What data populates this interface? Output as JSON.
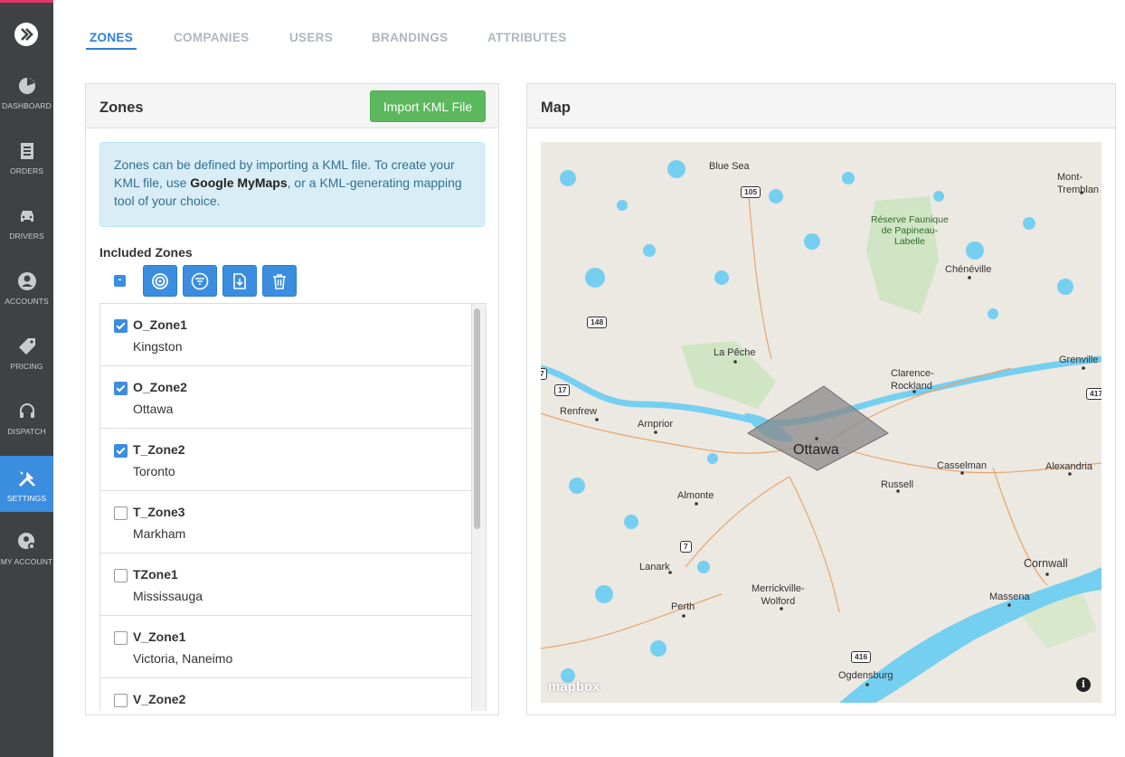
{
  "sidebar": {
    "items": [
      {
        "label": "DASHBOARD",
        "icon": "dashboard-icon"
      },
      {
        "label": "ORDERS",
        "icon": "orders-icon"
      },
      {
        "label": "DRIVERS",
        "icon": "car-icon"
      },
      {
        "label": "ACCOUNTS",
        "icon": "account-icon"
      },
      {
        "label": "PRICING",
        "icon": "price-tag-icon"
      },
      {
        "label": "DISPATCH",
        "icon": "headset-icon"
      },
      {
        "label": "SETTINGS",
        "icon": "wrench-icon"
      },
      {
        "label": "MY ACCOUNT",
        "icon": "user-gear-icon"
      }
    ],
    "active_index": 6
  },
  "tabs": {
    "zones": "ZONES",
    "companies": "COMPANIES",
    "users": "USERS",
    "brandings": "BRANDINGS",
    "attributes": "ATTRIBUTES"
  },
  "zones_panel": {
    "title": "Zones",
    "import_button": "Import KML File",
    "info_pre": "Zones can be defined by importing a KML file. To create your KML file, use ",
    "info_link": "Google MyMaps",
    "info_post": ", or a KML-generating mapping tool of your choice.",
    "included_label": "Included Zones",
    "bulk_toggle": "-",
    "toolbar_icons": [
      "target-icon",
      "filter-icon",
      "download-icon",
      "trash-icon"
    ],
    "zones": [
      {
        "name": "O_Zone1",
        "city": "Kingston",
        "checked": true
      },
      {
        "name": "O_Zone2",
        "city": "Ottawa",
        "checked": true
      },
      {
        "name": "T_Zone2",
        "city": "Toronto",
        "checked": true
      },
      {
        "name": "T_Zone3",
        "city": "Markham",
        "checked": false
      },
      {
        "name": "TZone1",
        "city": "Mississauga",
        "checked": false
      },
      {
        "name": "V_Zone1",
        "city": "Victoria, Naneimo",
        "checked": false
      },
      {
        "name": "V_Zone2",
        "city": "",
        "checked": false
      }
    ]
  },
  "map_panel": {
    "title": "Map",
    "attribution": "mapbox",
    "info_button": "i",
    "labels": {
      "blue_sea": "Blue Sea",
      "mont_tremblant": "Mont-\nTremblan",
      "reserve": "Réserve Faunique\nde Papineau-\nLabelle",
      "cheneville": "Chénéville",
      "la_peche": "La Pêche",
      "clarence": "Clarence-\nRockland",
      "grenville": "Grenville",
      "renfrew": "Renfrew",
      "arnprior": "Arnprior",
      "ottawa": "Ottawa",
      "casselman": "Casselman",
      "alexandria": "Alexandria",
      "russell": "Russell",
      "almonte": "Almonte",
      "lanark": "Lanark",
      "merrickville": "Merrickville-\nWolford",
      "cornwall": "Cornwall",
      "massena": "Massena",
      "perth": "Perth",
      "ogdensburg": "Ogdensburg"
    },
    "shields": {
      "r105": "105",
      "r148": "148",
      "r17": "17",
      "r7": "7",
      "r416": "416",
      "r417": "417",
      "r7b": "7"
    },
    "colors": {
      "water": "#75cff0",
      "land": "#ece8e2",
      "park": "#cfe5c3",
      "zone_fill": "#8a8a8a"
    }
  },
  "colors": {
    "accent": "#3b8de0",
    "sidebar": "#3f4244",
    "success": "#5cb85c"
  }
}
